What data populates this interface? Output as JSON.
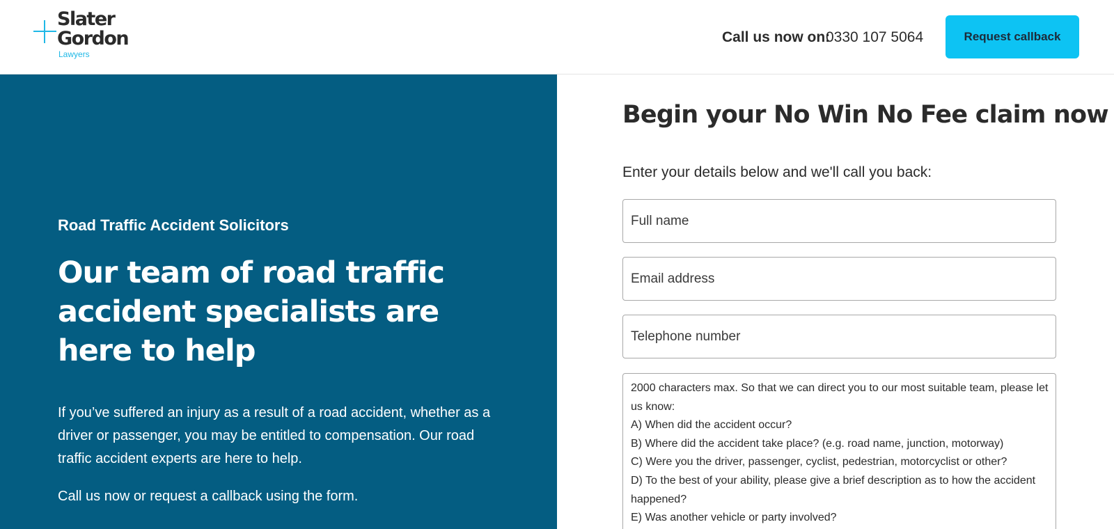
{
  "brand": {
    "line1": "Slater",
    "line2": "Gordon",
    "sub": "Lawyers",
    "accent": "#0dc3f3",
    "panel_color": "#045d82"
  },
  "header": {
    "call_label": "Call us now on:",
    "phone": "0330 107 5064",
    "callback_label": "Request callback"
  },
  "hero": {
    "eyebrow": "Road Traffic Accident Solicitors",
    "title": "Our team of road traffic accident specialists are here to help",
    "intro": "If you’ve suffered an injury as a result of a road accident, whether as a driver or passenger, you may be entitled to compensation. Our road traffic accident experts are here to help.",
    "cta": "Call us now or request a callback using the form."
  },
  "form": {
    "title": "Begin your No Win No Fee claim now",
    "intro": "Enter your details below and we'll call you back:",
    "name_placeholder": "Full name",
    "email_placeholder": "Email address",
    "phone_placeholder": "Telephone number",
    "message_lines": [
      "2000 characters max. So that we can direct you to our most suitable team, please let us know:",
      "A) When did the accident occur?",
      "B) Where did the accident take place? (e.g. road name, junction, motorway)",
      "C) Were you the driver, passenger, cyclist, pedestrian, motorcyclist or other?",
      "D) To the best of your ability, please give a brief description as to how the accident happened?",
      "E) Was another vehicle or party involved?"
    ]
  }
}
